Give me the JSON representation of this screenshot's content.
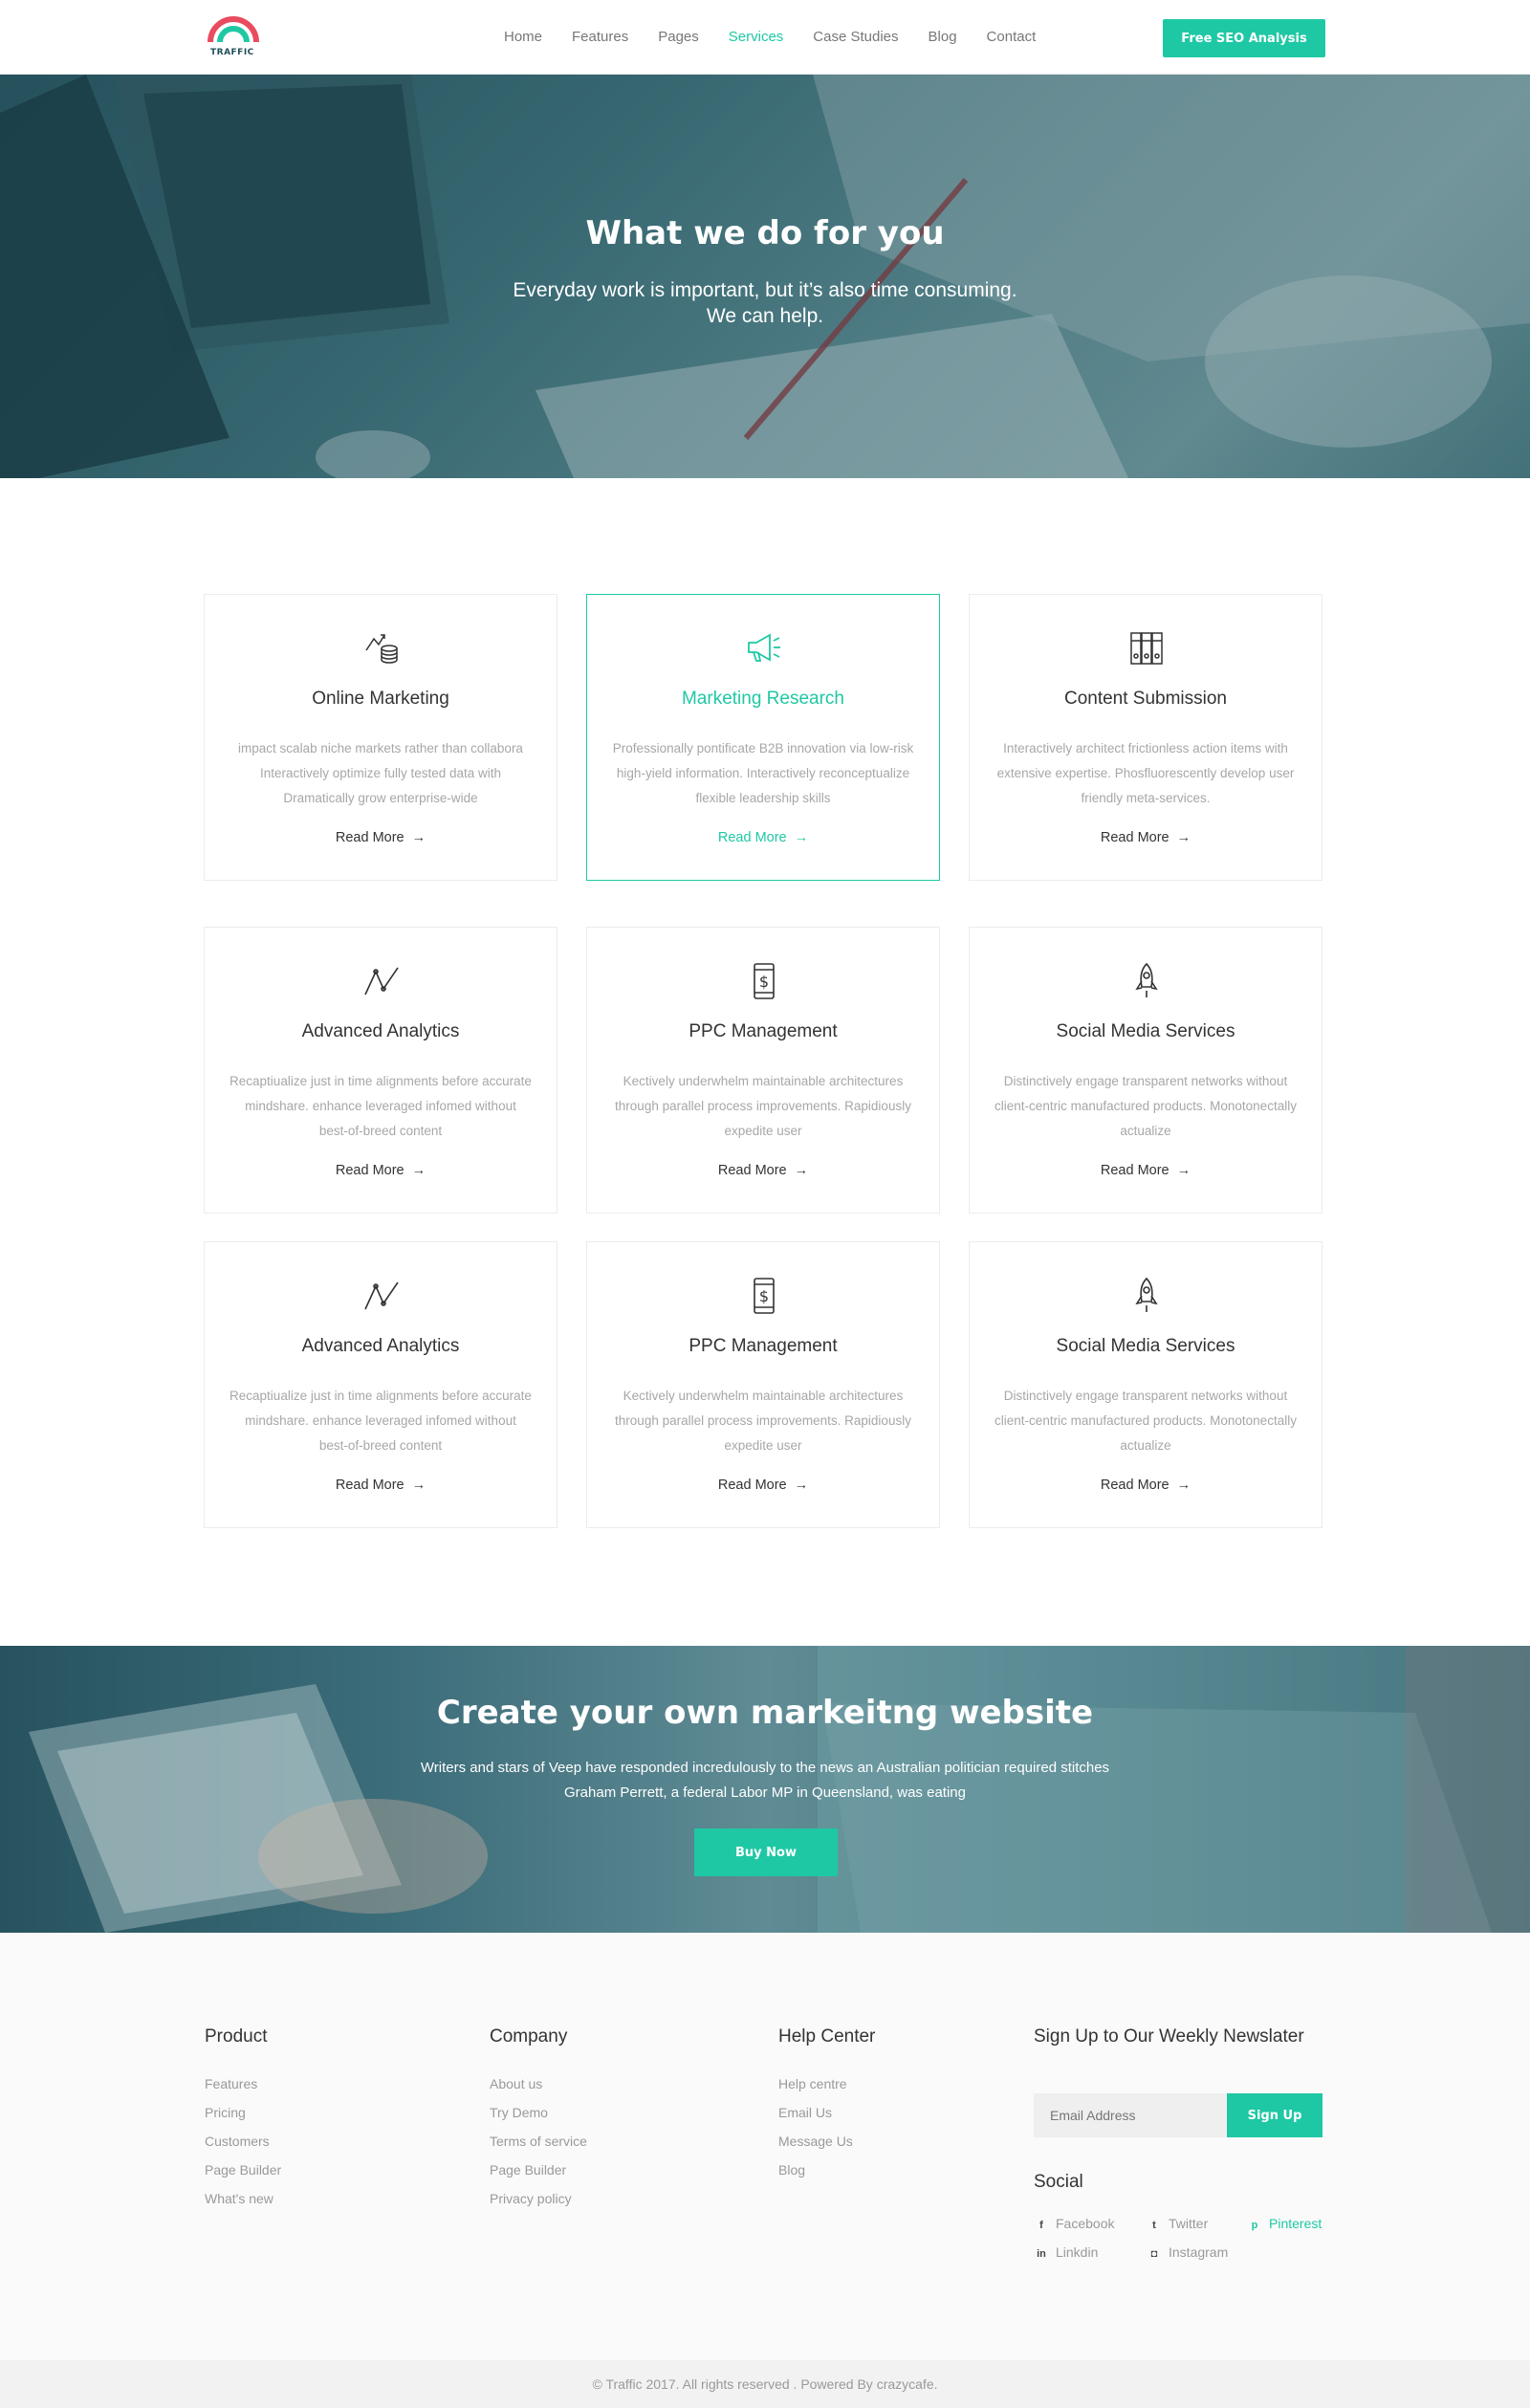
{
  "header": {
    "logo_text": "TRAFFIC",
    "nav": [
      "Home",
      "Features",
      "Pages",
      "Services",
      "Case Studies",
      "Blog",
      "Contact"
    ],
    "active_nav": "Services",
    "cta_label": "Free SEO Analysis"
  },
  "hero": {
    "title": "What we do for you",
    "subtitle_line1": "Everyday work is important, but it’s also time consuming.",
    "subtitle_line2": "We can help."
  },
  "services": [
    {
      "icon": "coins-growth-icon",
      "title": "Online Marketing",
      "desc": "impact scalab niche markets rather than collabora Interactively optimize fully tested data with Dramatically grow enterprise-wide",
      "more": "Read More",
      "active": false
    },
    {
      "icon": "megaphone-icon",
      "title": "Marketing Research",
      "desc": "Professionally pontificate B2B innovation via low-risk high-yield information. Interactively reconceptualize flexible leadership skills",
      "more": "Read More",
      "active": true
    },
    {
      "icon": "binders-icon",
      "title": "Content Submission",
      "desc": "Interactively architect frictionless action items with extensive expertise. Phosfluorescently develop user friendly meta-services.",
      "more": "Read More",
      "active": false
    },
    {
      "icon": "analytics-line-icon",
      "title": "Advanced Analytics",
      "desc": "Recaptiualize just in time alignments before accurate mindshare. enhance leveraged infomed without best-of-breed content",
      "more": "Read More",
      "active": false
    },
    {
      "icon": "phone-dollar-icon",
      "title": "PPC Management",
      "desc": "Kectively underwhelm maintainable architectures through parallel process improvements. Rapidiously expedite user",
      "more": "Read More",
      "active": false
    },
    {
      "icon": "rocket-icon",
      "title": "Social Media Services",
      "desc": "Distinctively engage transparent networks without client-centric manufactured products. Monotonectally actualize",
      "more": "Read More",
      "active": false
    },
    {
      "icon": "analytics-line-icon",
      "title": "Advanced Analytics",
      "desc": "Recaptiualize just in time alignments before accurate mindshare. enhance leveraged infomed without best-of-breed content",
      "more": "Read More",
      "active": false
    },
    {
      "icon": "phone-dollar-icon",
      "title": "PPC Management",
      "desc": "Kectively underwhelm maintainable architectures through parallel process improvements. Rapidiously expedite user",
      "more": "Read More",
      "active": false
    },
    {
      "icon": "rocket-icon",
      "title": "Social Media Services",
      "desc": "Distinctively engage transparent networks without client-centric manufactured products. Monotonectally actualize",
      "more": "Read More",
      "active": false
    }
  ],
  "banner": {
    "title": "Create your own markeitng website",
    "text_line1": "Writers and stars of Veep have responded incredulously to the news an Australian politician required stitches",
    "text_line2": "Graham Perrett, a federal Labor MP in Queensland, was eating",
    "button": "Buy Now"
  },
  "footer": {
    "product": {
      "title": "Product",
      "items": [
        "Features",
        "Pricing",
        "Customers",
        "Page Builder",
        "What's new"
      ]
    },
    "company": {
      "title": "Company",
      "items": [
        "About us",
        "Try Demo",
        "Terms of service",
        "Page Builder",
        "Privacy policy"
      ]
    },
    "help": {
      "title": "Help Center",
      "items": [
        "Help centre",
        "Email Us",
        "Message Us",
        "Blog"
      ]
    },
    "newsletter": {
      "title": "Sign Up to Our Weekly Newslater",
      "placeholder": "Email Address",
      "button": "Sign Up"
    },
    "social": {
      "title": "Social",
      "links": [
        {
          "label": "Facebook",
          "icon": "facebook-icon",
          "glyph": "f"
        },
        {
          "label": "Twitter",
          "icon": "twitter-icon",
          "glyph": "t"
        },
        {
          "label": "Pinterest",
          "icon": "pinterest-icon",
          "glyph": "p"
        },
        {
          "label": "Linkdin",
          "icon": "linkedin-icon",
          "glyph": "in"
        },
        {
          "label": "Instagram",
          "icon": "instagram-icon",
          "glyph": "◘"
        }
      ]
    },
    "copyright": "© Traffic 2017. All rights reserved . Powered By crazycafe."
  },
  "colors": {
    "accent": "#1fc8a4",
    "logo_red": "#e94b5f",
    "logo_teal": "#1fc8a4"
  }
}
